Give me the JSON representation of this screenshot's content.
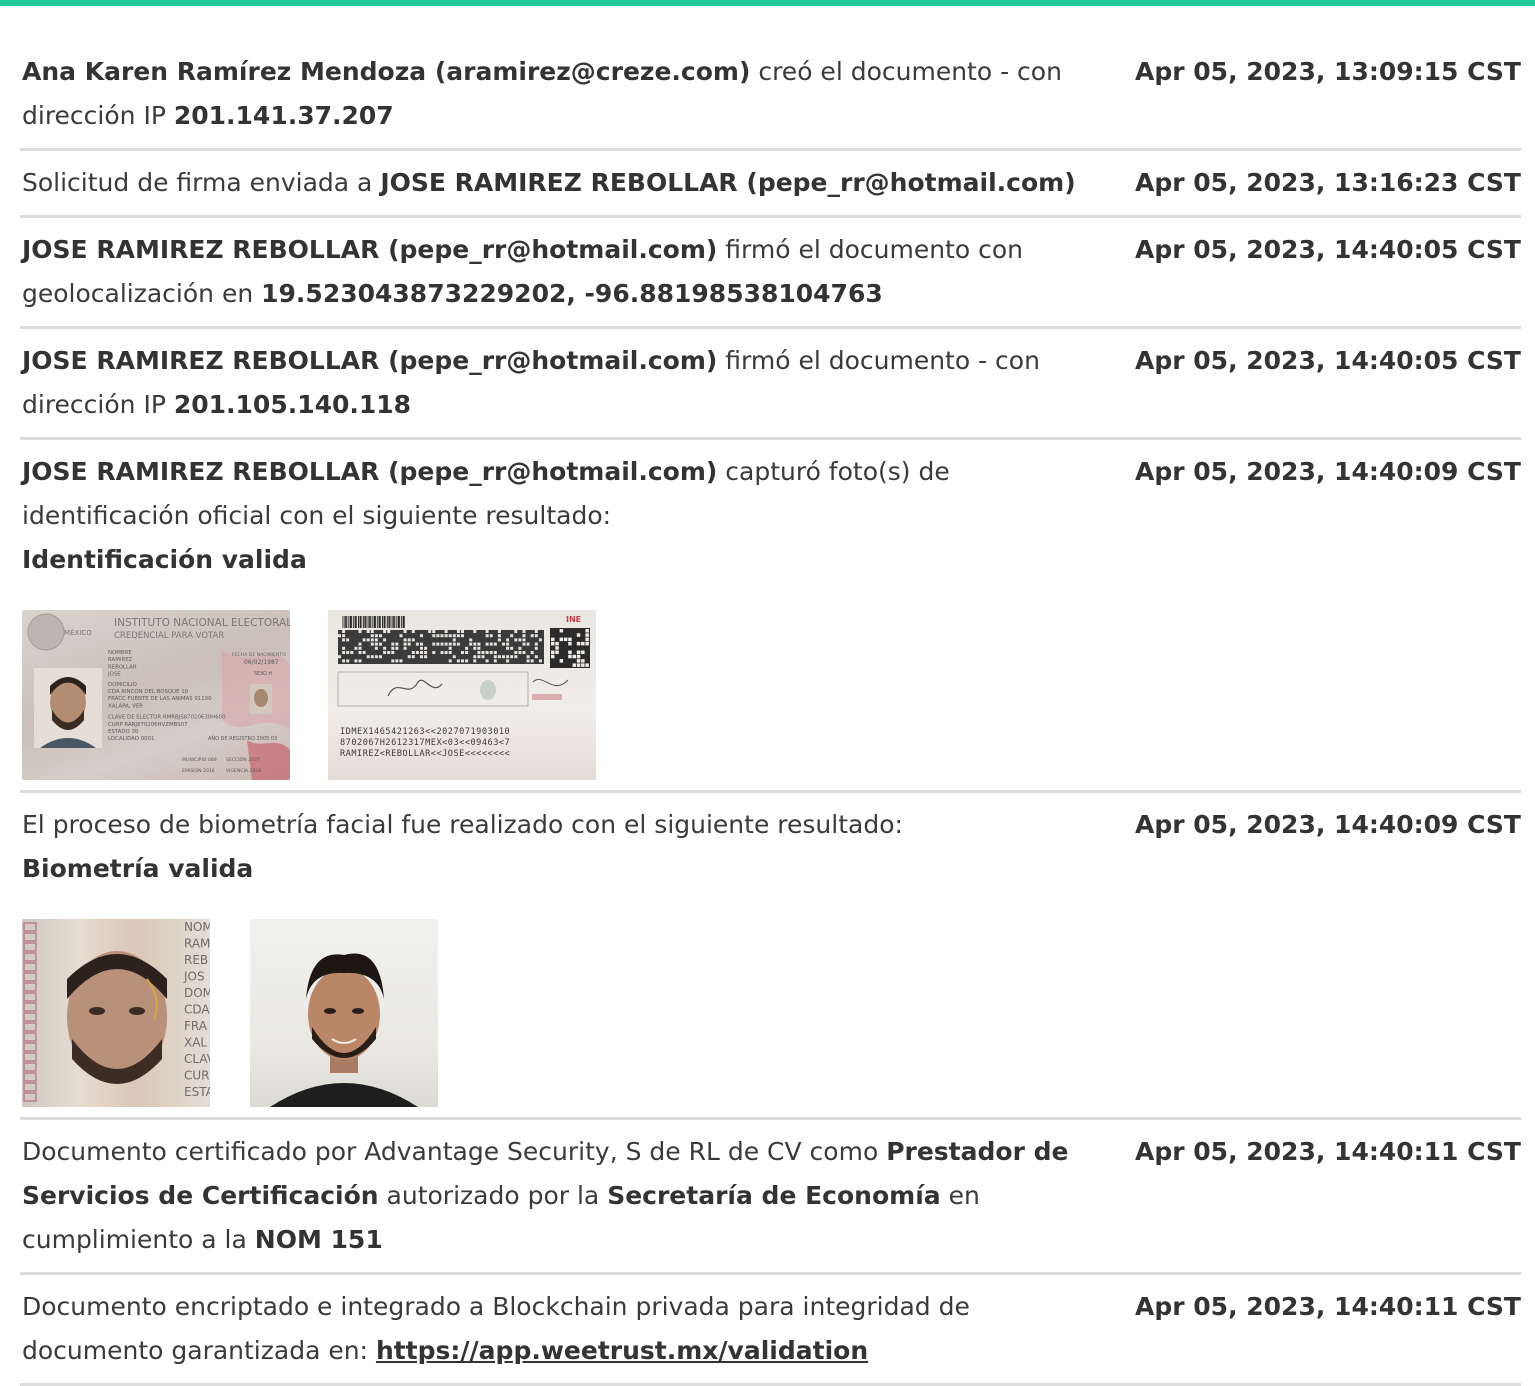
{
  "accent_color": "#1fc99a",
  "events": [
    {
      "parts": [
        {
          "b": "Ana Karen Ramírez Mendoza (aramirez@creze.com)"
        },
        {
          "t": " creó el documento - con dirección IP "
        },
        {
          "b": "201.141.37.207"
        }
      ],
      "time": "Apr 05, 2023, 13:09:15 CST"
    },
    {
      "parts": [
        {
          "t": "Solicitud de firma enviada a "
        },
        {
          "b": "JOSE RAMIREZ REBOLLAR (pepe_rr@hotmail.com)"
        }
      ],
      "time": "Apr 05, 2023, 13:16:23 CST"
    },
    {
      "parts": [
        {
          "b": "JOSE RAMIREZ REBOLLAR (pepe_rr@hotmail.com)"
        },
        {
          "t": " firmó el documento con geolocalización en "
        },
        {
          "b": "19.523043873229202, -96.88198538104763"
        }
      ],
      "time": "Apr 05, 2023, 14:40:05 CST"
    },
    {
      "parts": [
        {
          "b": "JOSE RAMIREZ REBOLLAR (pepe_rr@hotmail.com)"
        },
        {
          "t": " firmó el documento - con dirección IP "
        },
        {
          "b": "201.105.140.118"
        }
      ],
      "time": "Apr 05, 2023, 14:40:05 CST"
    },
    {
      "parts": [
        {
          "b": "JOSE RAMIREZ REBOLLAR (pepe_rr@hotmail.com)"
        },
        {
          "t": " capturó foto(s) de identificación oficial con el siguiente resultado:"
        },
        {
          "br": true
        },
        {
          "b": "Identificación valida"
        }
      ],
      "time": "Apr 05, 2023, 14:40:09 CST",
      "id_card": {
        "front": {
          "country": "MÉXICO",
          "institute": "INSTITUTO NACIONAL ELECTORAL",
          "subtitle": "CREDENCIAL PARA VOTAR",
          "lines": [
            "NOMBRE",
            "RAMIREZ",
            "REBOLLAR",
            "JOSE",
            "DOMICILIO",
            "CDA RINCON DEL BOSQUE 10",
            "FRACC FUENTE DE LAS ANIMAS 91190",
            "XALAPA, VER",
            "CLAVE DE ELECTOR RMRBJS87020630H600",
            "CURP RARJ870206HVZMBS07",
            "ESTADO 30",
            "LOCALIDAD 0001"
          ],
          "birth_label": "FECHA DE NACIMIENTO",
          "birth_value": "06/02/1987",
          "sex": "SEXO H",
          "registro": "AÑO DE REGISTRO 2005 03",
          "municipio": "MUNICIPIO 089",
          "seccion": "SECCIÓN 2027",
          "emision": "EMISIÓN 2016",
          "vigencia": "VIGENCIA 2026"
        },
        "back": {
          "brand": "INE",
          "mrz": [
            "IDMEX1465421263<<2027071903010",
            "8702067H2612317MEX<03<<09463<7",
            "RAMIREZ<REBOLLAR<<JOSE<<<<<<<<"
          ]
        }
      }
    },
    {
      "parts": [
        {
          "t": "El proceso de biometría facial fue realizado con el siguiente resultado:"
        },
        {
          "br": true
        },
        {
          "b": "Biometría valida"
        }
      ],
      "time": "Apr 05, 2023, 14:40:09 CST",
      "face_crop_text": [
        "NOM",
        "RAM",
        "REB",
        "JOS",
        "DOM",
        "CDA",
        "FRA",
        "XAL",
        "CLAV",
        "CURI",
        "ESTA"
      ]
    },
    {
      "parts": [
        {
          "t": "Documento certificado por Advantage Security, S de RL de CV como "
        },
        {
          "b": "Prestador de Servicios de Certificación"
        },
        {
          "t": " autorizado por la "
        },
        {
          "b": "Secretaría de Economía"
        },
        {
          "t": " en cumplimiento a la "
        },
        {
          "b": "NOM 151"
        }
      ],
      "time": "Apr 05, 2023, 14:40:11 CST"
    },
    {
      "parts": [
        {
          "t": "Documento encriptado e integrado a Blockchain privada para integridad de documento garantizada en: "
        },
        {
          "link": "https://app.weetrust.mx/validation"
        }
      ],
      "time": "Apr 05, 2023, 14:40:11 CST"
    }
  ]
}
